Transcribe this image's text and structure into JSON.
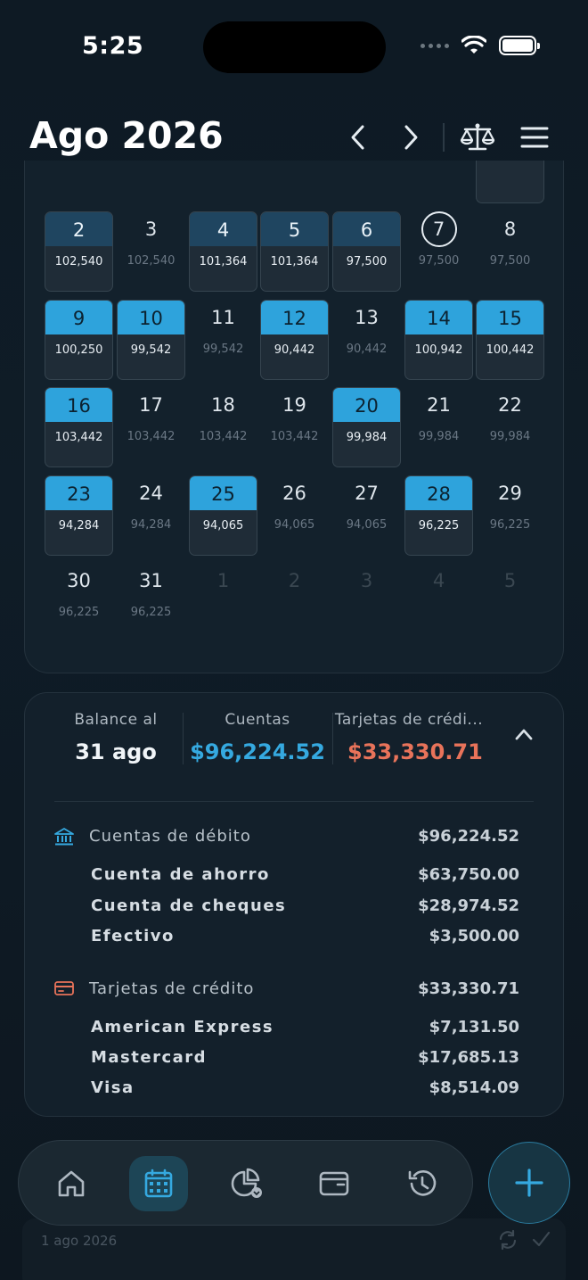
{
  "status": {
    "time": "5:25"
  },
  "header": {
    "title": "Ago 2026"
  },
  "calendar": {
    "weeks": [
      [
        {
          "d": "2",
          "a": "102,540",
          "k": "tx"
        },
        {
          "d": "3",
          "a": "102,540",
          "k": "plain"
        },
        {
          "d": "4",
          "a": "101,364",
          "k": "tx"
        },
        {
          "d": "5",
          "a": "101,364",
          "k": "tx"
        },
        {
          "d": "6",
          "a": "97,500",
          "k": "tx"
        },
        {
          "d": "7",
          "a": "97,500",
          "k": "today"
        },
        {
          "d": "8",
          "a": "97,500",
          "k": "plain"
        }
      ],
      [
        {
          "d": "9",
          "a": "100,250",
          "k": "sel"
        },
        {
          "d": "10",
          "a": "99,542",
          "k": "sel"
        },
        {
          "d": "11",
          "a": "99,542",
          "k": "plain"
        },
        {
          "d": "12",
          "a": "90,442",
          "k": "sel"
        },
        {
          "d": "13",
          "a": "90,442",
          "k": "plain"
        },
        {
          "d": "14",
          "a": "100,942",
          "k": "sel"
        },
        {
          "d": "15",
          "a": "100,442",
          "k": "sel"
        }
      ],
      [
        {
          "d": "16",
          "a": "103,442",
          "k": "sel"
        },
        {
          "d": "17",
          "a": "103,442",
          "k": "plain"
        },
        {
          "d": "18",
          "a": "103,442",
          "k": "plain"
        },
        {
          "d": "19",
          "a": "103,442",
          "k": "plain"
        },
        {
          "d": "20",
          "a": "99,984",
          "k": "sel"
        },
        {
          "d": "21",
          "a": "99,984",
          "k": "plain"
        },
        {
          "d": "22",
          "a": "99,984",
          "k": "plain"
        }
      ],
      [
        {
          "d": "23",
          "a": "94,284",
          "k": "sel"
        },
        {
          "d": "24",
          "a": "94,284",
          "k": "plain"
        },
        {
          "d": "25",
          "a": "94,065",
          "k": "sel"
        },
        {
          "d": "26",
          "a": "94,065",
          "k": "plain"
        },
        {
          "d": "27",
          "a": "94,065",
          "k": "plain"
        },
        {
          "d": "28",
          "a": "96,225",
          "k": "sel"
        },
        {
          "d": "29",
          "a": "96,225",
          "k": "plain"
        }
      ],
      [
        {
          "d": "30",
          "a": "96,225",
          "k": "plain"
        },
        {
          "d": "31",
          "a": "96,225",
          "k": "plain"
        },
        {
          "d": "1",
          "a": "",
          "k": "other"
        },
        {
          "d": "2",
          "a": "",
          "k": "other"
        },
        {
          "d": "3",
          "a": "",
          "k": "other"
        },
        {
          "d": "4",
          "a": "",
          "k": "other"
        },
        {
          "d": "5",
          "a": "",
          "k": "other"
        }
      ]
    ]
  },
  "balance": {
    "date_label": "Balance al",
    "date_value": "31 ago",
    "accounts_label": "Cuentas",
    "accounts_value": "$96,224.52",
    "cards_label": "Tarjetas de crédi...",
    "cards_value": "$33,330.71",
    "colors": {
      "accounts": "#35a9e0",
      "cards": "#e8735a"
    },
    "debit": {
      "title": "Cuentas de débito",
      "total": "$96,224.52",
      "icon": "bank-icon",
      "items": [
        {
          "name": "Cuenta de ahorro",
          "value": "$63,750.00"
        },
        {
          "name": "Cuenta de cheques",
          "value": "$28,974.52"
        },
        {
          "name": "Efectivo",
          "value": "$3,500.00"
        }
      ]
    },
    "credit": {
      "title": "Tarjetas de crédito",
      "total": "$33,330.71",
      "icon": "credit-card-icon",
      "items": [
        {
          "name": "American Express",
          "value": "$7,131.50"
        },
        {
          "name": "Mastercard",
          "value": "$17,685.13"
        },
        {
          "name": "Visa",
          "value": "$8,514.09"
        }
      ]
    }
  },
  "nav": {
    "items": [
      "home-icon",
      "calendar-icon",
      "pie-chart-icon",
      "wallet-icon",
      "history-icon"
    ],
    "active": "calendar-icon"
  },
  "peek": {
    "date": "1 ago 2026"
  }
}
